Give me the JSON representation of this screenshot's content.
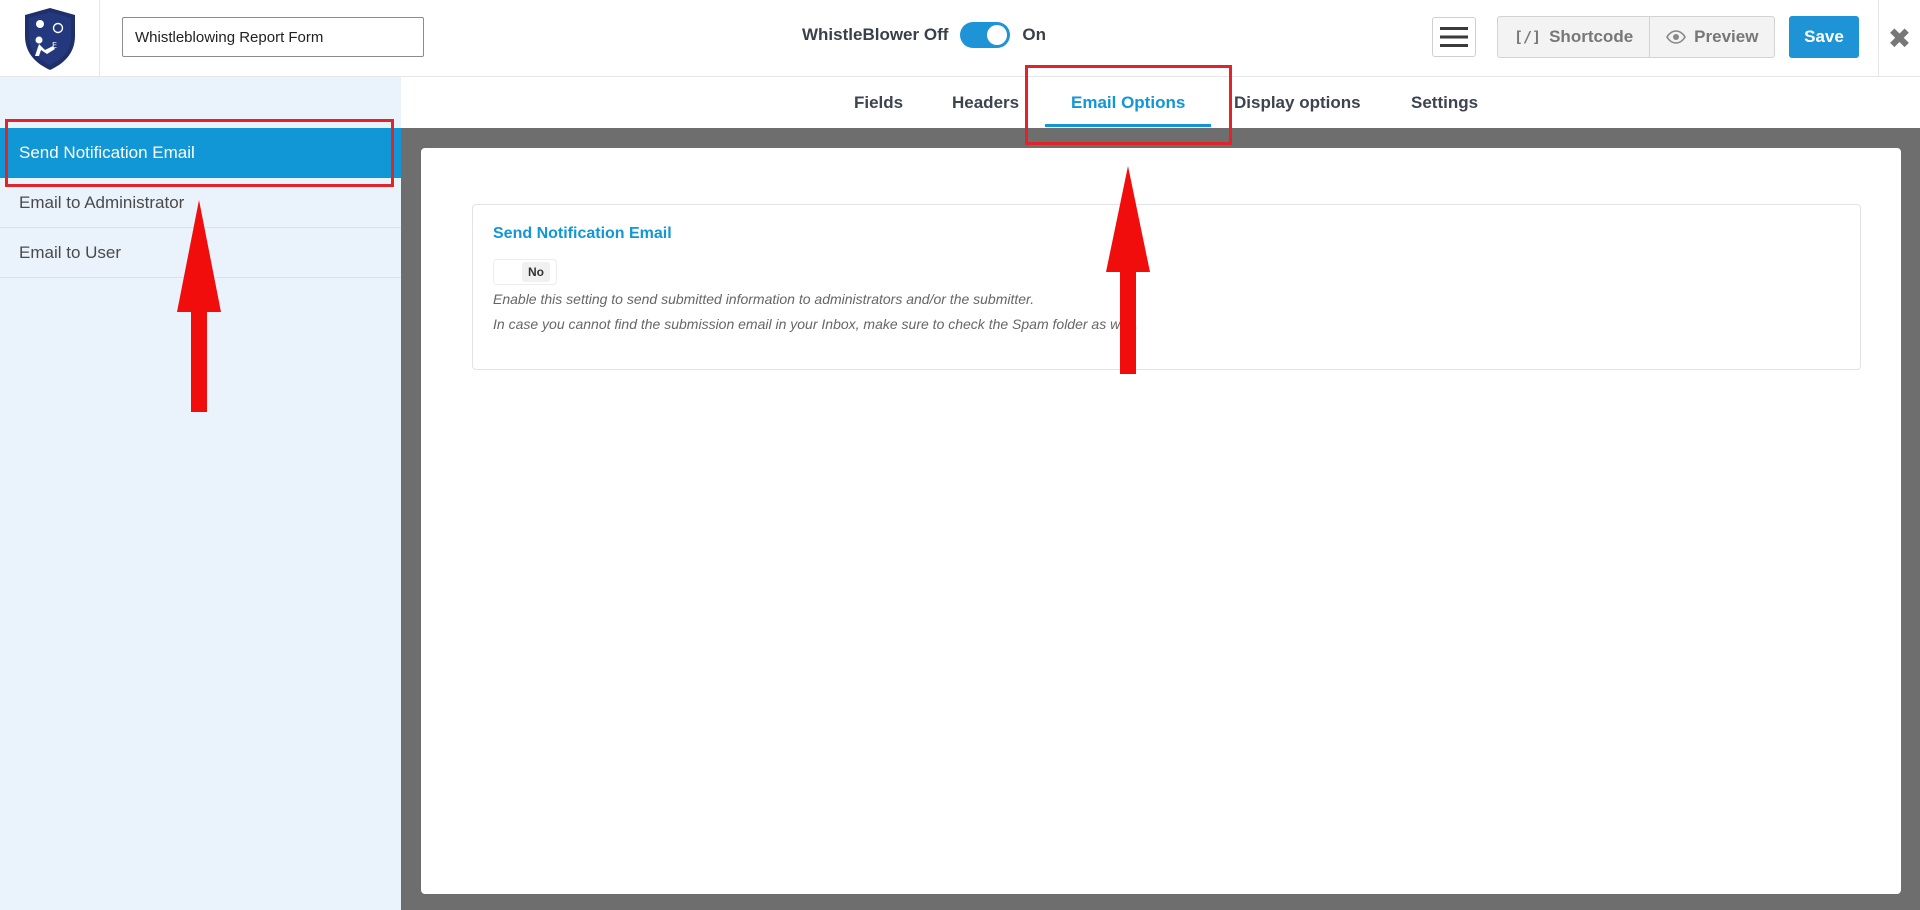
{
  "header": {
    "logo": "whistleblower-shield-logo",
    "form_title": "Whistleblowing Report Form",
    "toggle": {
      "label_off": "WhistleBlower Off",
      "label_on": "On",
      "state": "on"
    },
    "menu_icon": "hamburger-icon",
    "shortcode_label": "Shortcode",
    "shortcode_icon": "[/]",
    "preview_label": "Preview",
    "save_label": "Save",
    "close_glyph": "✖"
  },
  "sidebar": {
    "items": [
      {
        "label": "Send Notification Email",
        "active": true
      },
      {
        "label": "Email to Administrator",
        "active": false
      },
      {
        "label": "Email to User",
        "active": false
      }
    ]
  },
  "tabs": [
    {
      "label": "Fields",
      "active": false
    },
    {
      "label": "Headers",
      "active": false
    },
    {
      "label": "Email Options",
      "active": true
    },
    {
      "label": "Display options",
      "active": false
    },
    {
      "label": "Settings",
      "active": false
    }
  ],
  "card": {
    "title": "Send Notification Email",
    "toggle_value": "No",
    "help_1": "Enable this setting to send submitted information to administrators and/or the submitter.",
    "help_2": "In case you cannot find the submission email in your Inbox, make sure to check the Spam folder as well."
  },
  "colors": {
    "accent": "#1196d6",
    "annotation": "#e0242a",
    "sidebar_bg": "#eaf2fb",
    "content_bg": "#6e6e6e"
  }
}
